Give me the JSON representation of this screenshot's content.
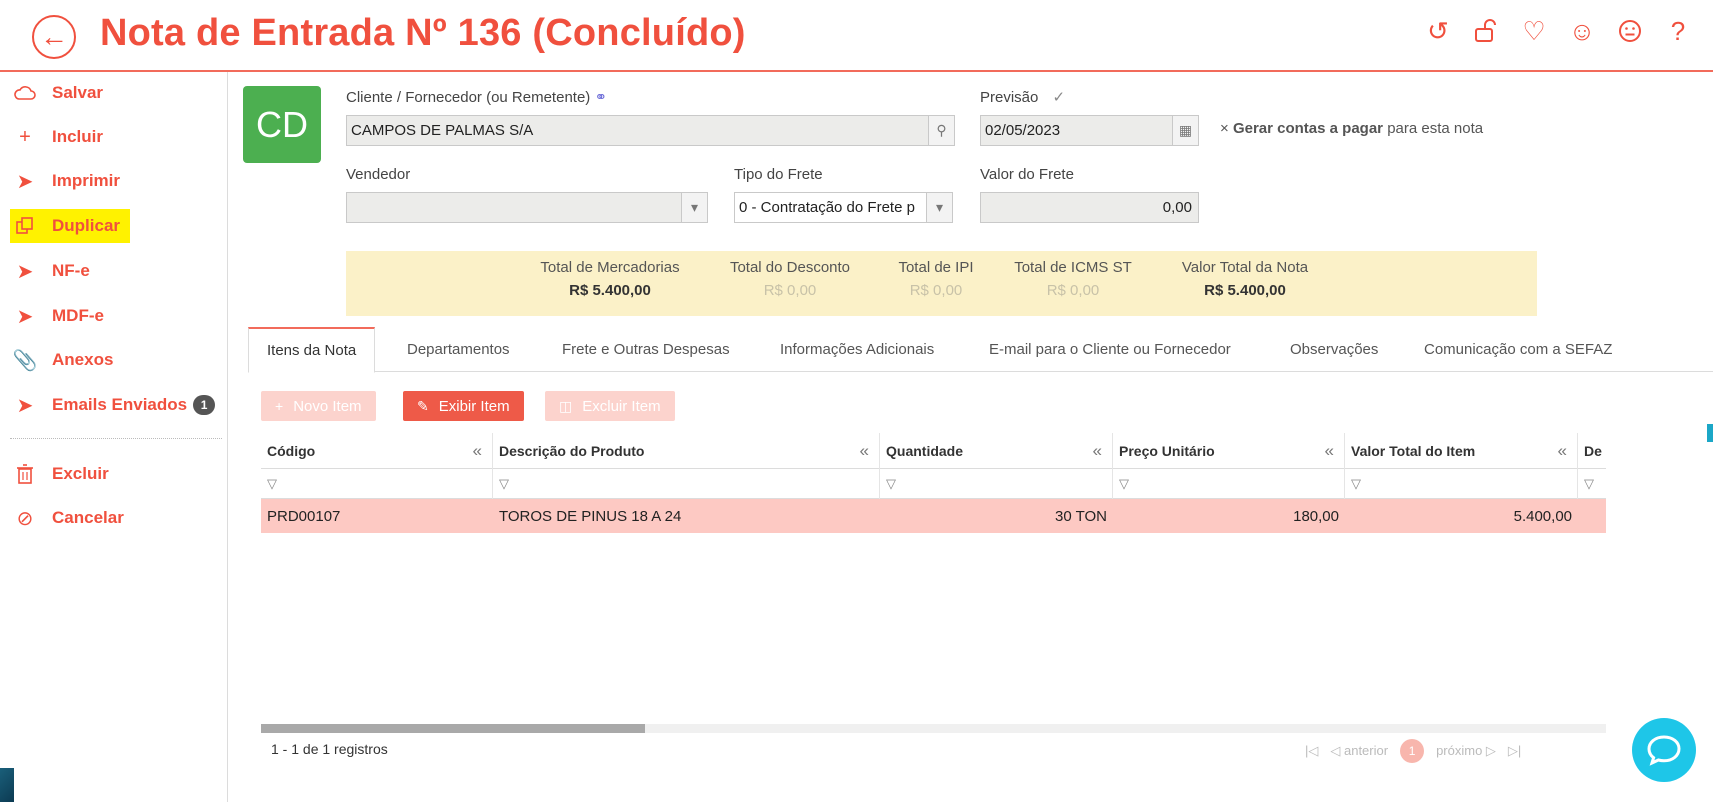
{
  "header": {
    "title": "Nota de Entrada Nº 136 (Concluído)",
    "icons": [
      "history-icon",
      "unlock-icon",
      "heart-icon",
      "smile-icon",
      "neutral-face-icon",
      "help-icon"
    ]
  },
  "sidebar": {
    "items": [
      {
        "label": "Salvar",
        "icon": "cloud-icon"
      },
      {
        "label": "Incluir",
        "icon": "plus-icon"
      },
      {
        "label": "Imprimir",
        "icon": "send-icon"
      },
      {
        "label": "Duplicar",
        "icon": "copy-icon"
      },
      {
        "label": "NF-e",
        "icon": "send-icon"
      },
      {
        "label": "MDF-e",
        "icon": "send-icon"
      },
      {
        "label": "Anexos",
        "icon": "paperclip-icon"
      },
      {
        "label": "Emails Enviados",
        "icon": "send-icon",
        "badge": "1"
      },
      {
        "label": "Excluir",
        "icon": "trash-icon"
      },
      {
        "label": "Cancelar",
        "icon": "ban-icon"
      }
    ]
  },
  "form": {
    "avatar_initials": "CD",
    "cliente_label": "Cliente / Fornecedor (ou Remetente)",
    "cliente_value": "CAMPOS DE PALMAS S/A",
    "previsao_label": "Previsão",
    "previsao_value": "02/05/2023",
    "gerar_prefix": "×",
    "gerar_bold": "Gerar contas a pagar",
    "gerar_rest": "para esta nota",
    "vendedor_label": "Vendedor",
    "vendedor_value": "",
    "tipo_frete_label": "Tipo do Frete",
    "tipo_frete_value": "0 - Contratação do Frete p",
    "valor_frete_label": "Valor do Frete",
    "valor_frete_value": "0,00"
  },
  "totals": {
    "mercadorias_label": "Total de Mercadorias",
    "mercadorias_value": "R$ 5.400,00",
    "desconto_label": "Total do Desconto",
    "desconto_value": "R$ 0,00",
    "ipi_label": "Total de IPI",
    "ipi_value": "R$ 0,00",
    "icms_label": "Total de ICMS ST",
    "icms_value": "R$ 0,00",
    "nota_label": "Valor Total da Nota",
    "nota_value": "R$ 5.400,00"
  },
  "tabs": [
    "Itens da Nota",
    "Departamentos",
    "Frete e Outras Despesas",
    "Informações Adicionais",
    "E-mail para o Cliente ou Fornecedor",
    "Observações",
    "Comunicação com a SEFAZ"
  ],
  "toolbar": {
    "novo_label": "Novo Item",
    "exibir_label": "Exibir Item",
    "excluir_label": "Excluir Item"
  },
  "grid": {
    "columns": [
      "Código",
      "Descrição do Produto",
      "Quantidade",
      "Preço Unitário",
      "Valor Total do Item",
      "De"
    ],
    "rows": [
      [
        "PRD00107",
        "TOROS DE PINUS 18 A 24",
        "30 TON",
        "180,00",
        "5.400,00"
      ]
    ],
    "records_text": "1 - 1 de 1 registros"
  },
  "pager": {
    "anterior": "anterior",
    "page": "1",
    "proximo": "próximo"
  }
}
